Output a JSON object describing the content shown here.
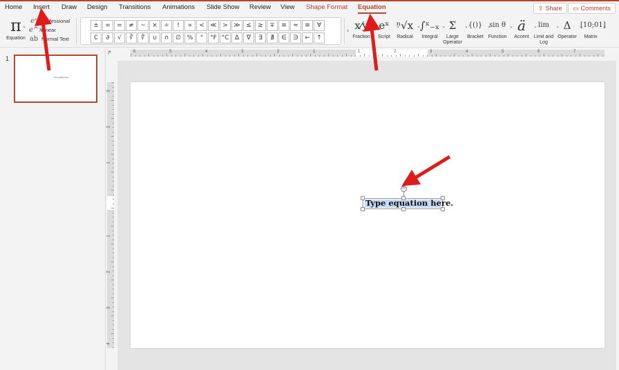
{
  "tabs": [
    {
      "label": "Home",
      "state": "normal"
    },
    {
      "label": "Insert",
      "state": "normal"
    },
    {
      "label": "Draw",
      "state": "normal"
    },
    {
      "label": "Design",
      "state": "normal"
    },
    {
      "label": "Transitions",
      "state": "normal"
    },
    {
      "label": "Animations",
      "state": "normal"
    },
    {
      "label": "Slide Show",
      "state": "normal"
    },
    {
      "label": "Review",
      "state": "normal"
    },
    {
      "label": "View",
      "state": "normal"
    },
    {
      "label": "Shape Format",
      "state": "contextual"
    },
    {
      "label": "Equation",
      "state": "active"
    }
  ],
  "top_buttons": {
    "share": {
      "label": "Share",
      "icon": "share-icon"
    },
    "comments": {
      "label": "Comments",
      "icon": "comment-icon"
    }
  },
  "ribbon": {
    "equation_button": {
      "label": "Equation",
      "icon": "π"
    },
    "conversions": [
      {
        "label": "Professional",
        "icon": "eˣ"
      },
      {
        "label": "Linear",
        "icon": "e^x"
      },
      {
        "label": "Normal Text",
        "icon": "ab"
      }
    ],
    "symbols_row1": [
      "±",
      "∞",
      "=",
      "≠",
      "~",
      "×",
      "÷",
      "!",
      "∝",
      "<",
      "≪",
      ">",
      "≫",
      "≤",
      "≥",
      "∓",
      "≅",
      "≈",
      "≡",
      "∀"
    ],
    "symbols_row2": [
      "∁",
      "∂",
      "√",
      "∛",
      "∜",
      "∪",
      "∩",
      "∅",
      "%",
      "°",
      "°F",
      "°C",
      "∆",
      "∇",
      "∃",
      "∄",
      "∈",
      "∋",
      "←",
      "↑"
    ],
    "symbols_more": "›",
    "structures": [
      {
        "label": "Fraction",
        "glyph": "x⁄y"
      },
      {
        "label": "Script",
        "glyph": "eˣ"
      },
      {
        "label": "Radical",
        "glyph": "ⁿ√x"
      },
      {
        "label": "Integral",
        "glyph": "∫ˣ₋ₓ"
      },
      {
        "label": "Large Operator",
        "glyph": "Σ"
      },
      {
        "label": "Bracket",
        "glyph": "{()}"
      },
      {
        "label": "Function",
        "glyph": "sin θ"
      },
      {
        "label": "Accent",
        "glyph": "ä"
      },
      {
        "label": "Limit and Log",
        "glyph": "lim"
      },
      {
        "label": "Operator",
        "glyph": "Δ"
      },
      {
        "label": "Matrix",
        "glyph": "[10;01]"
      }
    ]
  },
  "thumbnails": [
    {
      "number": "1",
      "preview_text": "Type equation here.",
      "selected": true
    }
  ],
  "rulers": {
    "horizontal": [
      "6",
      "5",
      "4",
      "3",
      "2",
      "1",
      "1",
      "2",
      "3",
      "4",
      "5",
      "6",
      "7"
    ],
    "vertical": [
      "3",
      "2",
      "1",
      "1",
      "2",
      "3",
      "4"
    ]
  },
  "slide": {
    "equation_placeholder": "Type equation here."
  },
  "colors": {
    "accent": "#b5432f",
    "selection": "#c5dbf7",
    "annotation_arrow": "#e01b1b"
  }
}
